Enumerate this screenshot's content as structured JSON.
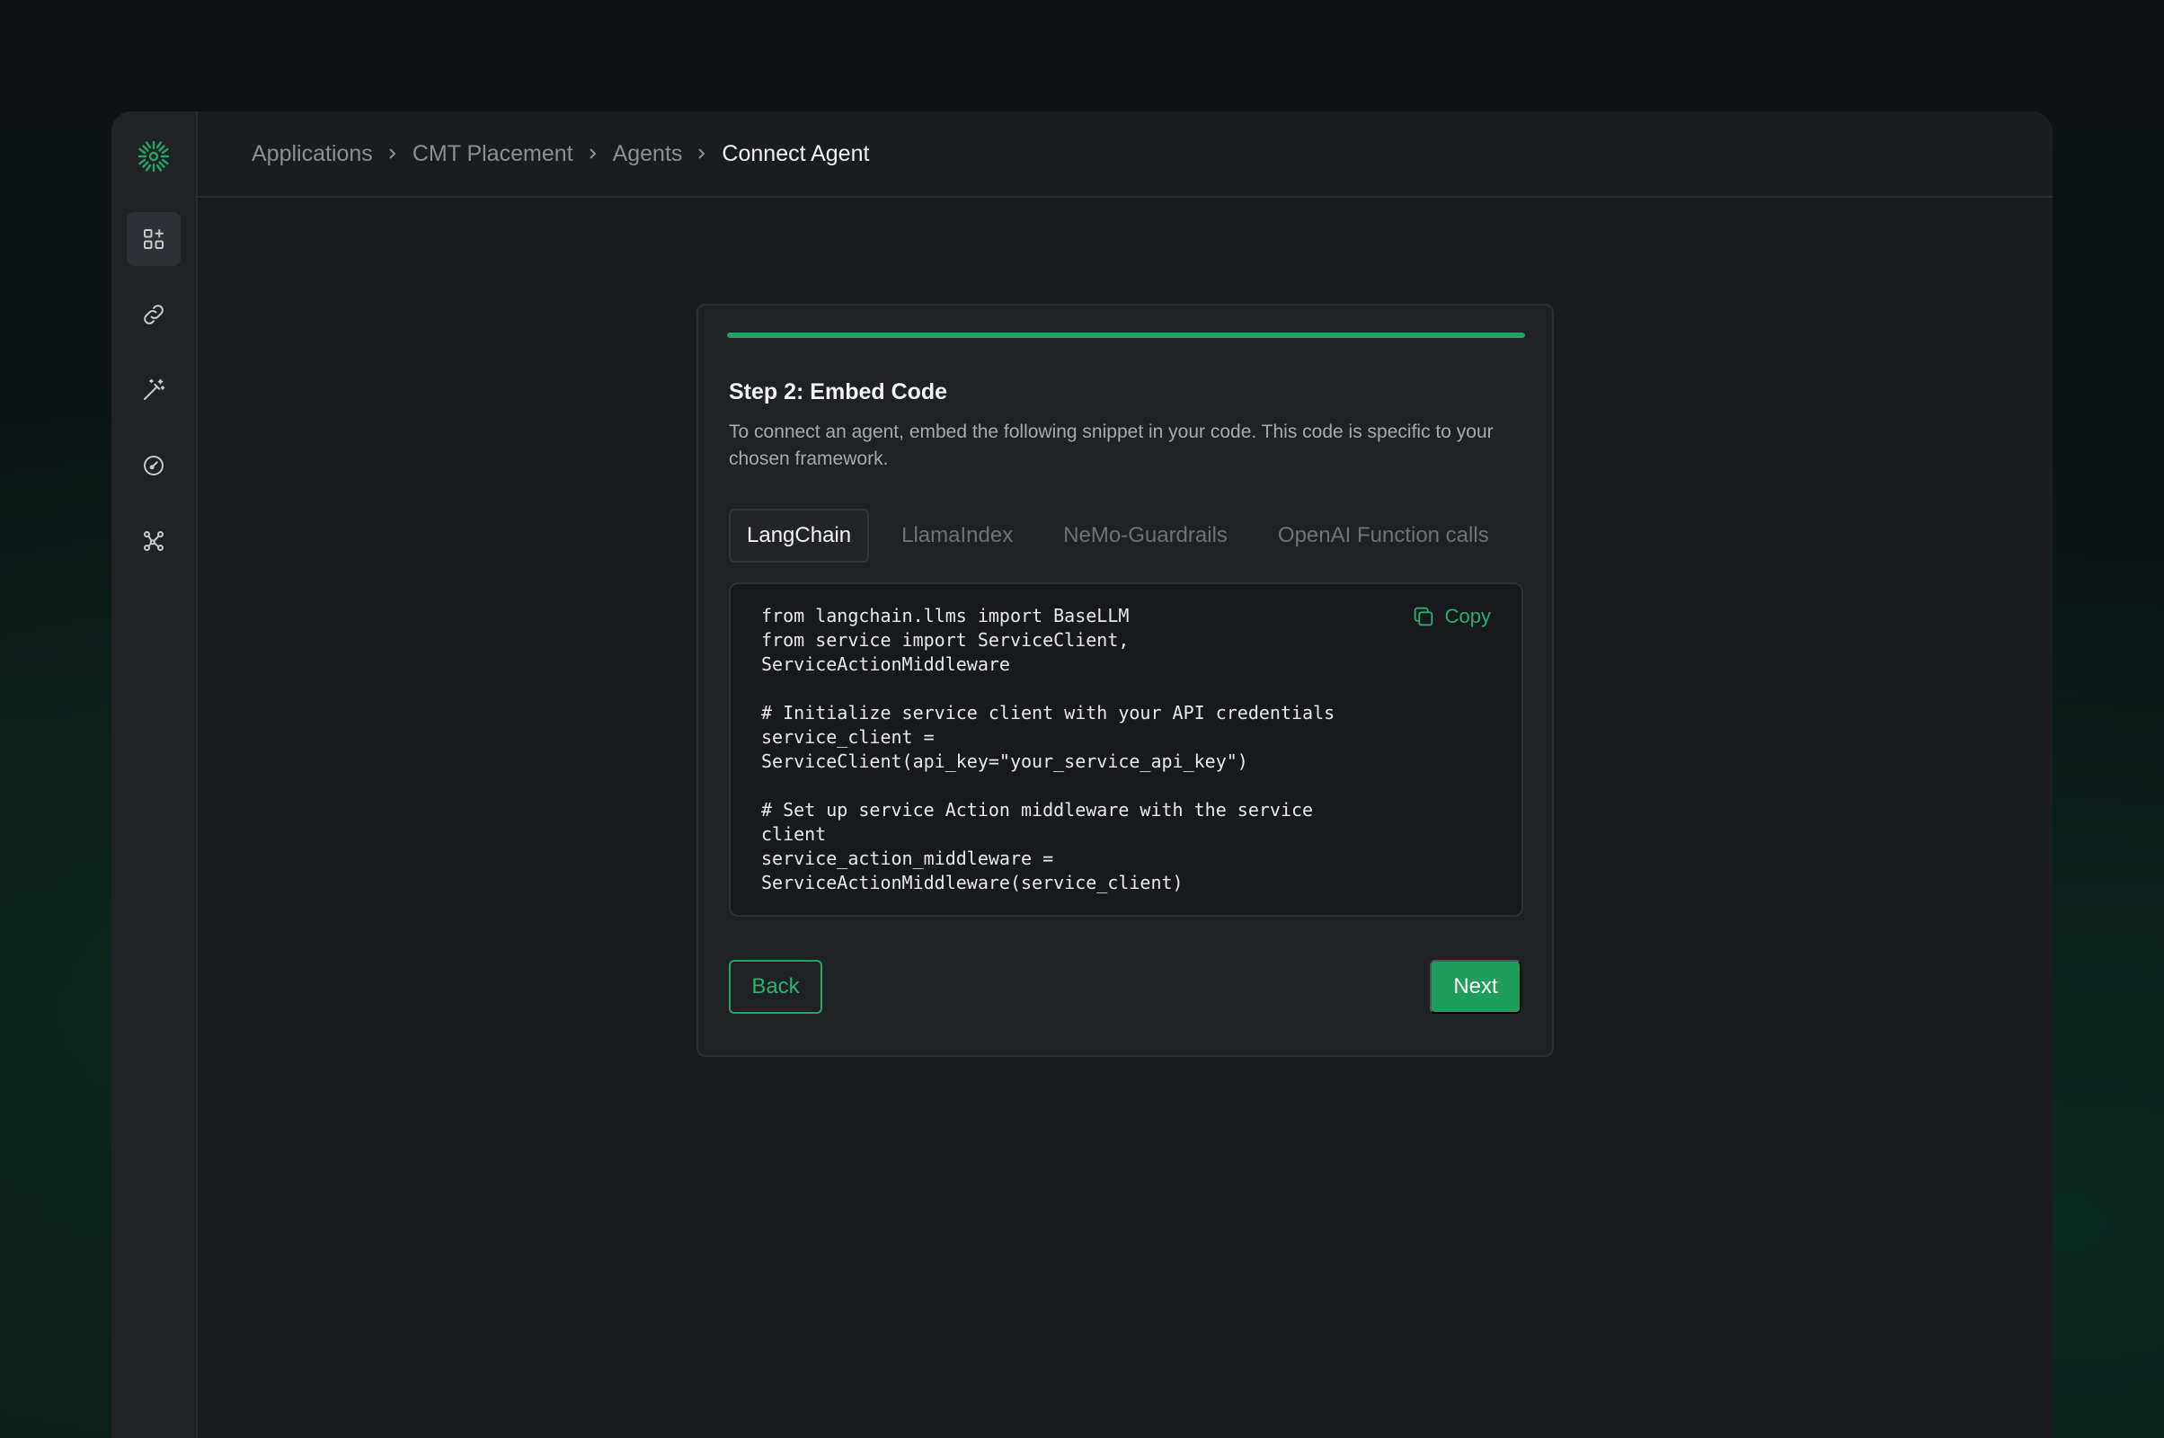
{
  "breadcrumb": {
    "items": [
      "Applications",
      "CMT Placement",
      "Agents",
      "Connect Agent"
    ]
  },
  "sidebar": {
    "items": [
      {
        "icon": "grid-plus-icon",
        "active": true
      },
      {
        "icon": "link-icon",
        "active": false
      },
      {
        "icon": "magic-wand-icon",
        "active": false
      },
      {
        "icon": "gauge-icon",
        "active": false
      },
      {
        "icon": "network-icon",
        "active": false
      }
    ]
  },
  "wizard": {
    "progress_percent": 100,
    "title": "Step 2: Embed Code",
    "description": "To connect an agent, embed the following snippet in your code. This code is specific to your chosen framework.",
    "tabs": [
      {
        "label": "LangChain",
        "active": true
      },
      {
        "label": "LlamaIndex",
        "active": false
      },
      {
        "label": "NeMo-Guardrails",
        "active": false
      },
      {
        "label": "OpenAI Function calls",
        "active": false
      }
    ],
    "code": "from langchain.llms import BaseLLM\nfrom service import ServiceClient,\nServiceActionMiddleware\n\n# Initialize service client with your API credentials\nservice_client =\nServiceClient(api_key=\"your_service_api_key\")\n\n# Set up service Action middleware with the service\nclient\nservice_action_middleware =\nServiceActionMiddleware(service_client)",
    "copy_label": "Copy",
    "back_label": "Back",
    "next_label": "Next"
  },
  "colors": {
    "accent": "#1f9d5d",
    "window_bg": "#1b1c1f",
    "sidebar_bg": "#212226"
  }
}
